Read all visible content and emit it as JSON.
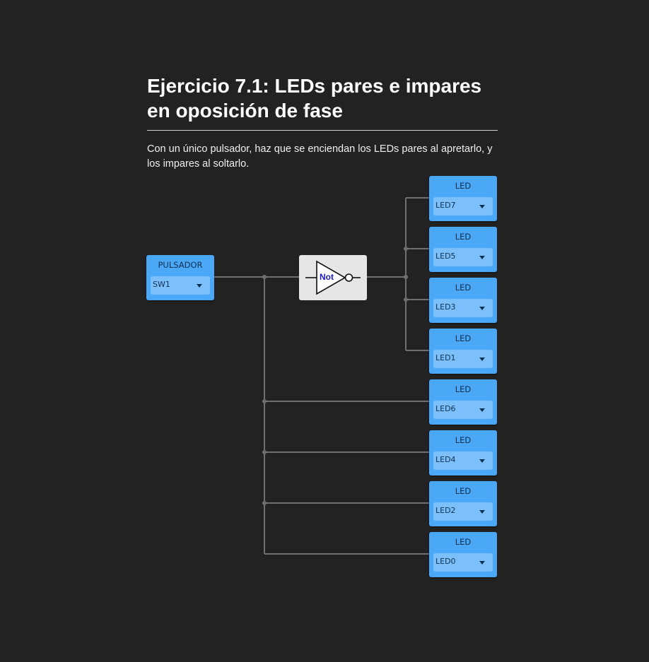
{
  "page": {
    "title": "Ejercicio 7.1: LEDs pares e impares en oposición de fase",
    "description": "Con un único pulsador, haz que se enciendan los LEDs pares al apretarlo, y los impares al soltarlo."
  },
  "input_block": {
    "type_label": "PULSADOR",
    "selected": "SW1"
  },
  "gate": {
    "label": "Not"
  },
  "leds": [
    {
      "type_label": "LED",
      "selected": "LED7"
    },
    {
      "type_label": "LED",
      "selected": "LED5"
    },
    {
      "type_label": "LED",
      "selected": "LED3"
    },
    {
      "type_label": "LED",
      "selected": "LED1"
    },
    {
      "type_label": "LED",
      "selected": "LED6"
    },
    {
      "type_label": "LED",
      "selected": "LED4"
    },
    {
      "type_label": "LED",
      "selected": "LED2"
    },
    {
      "type_label": "LED",
      "selected": "LED0"
    }
  ],
  "colors": {
    "background": "#222222",
    "block": "#4aa8f7",
    "select": "#7cc0fb",
    "wire": "#6f6f6f",
    "gate": "#e6e6e6",
    "gate_label": "#1a1acc"
  }
}
